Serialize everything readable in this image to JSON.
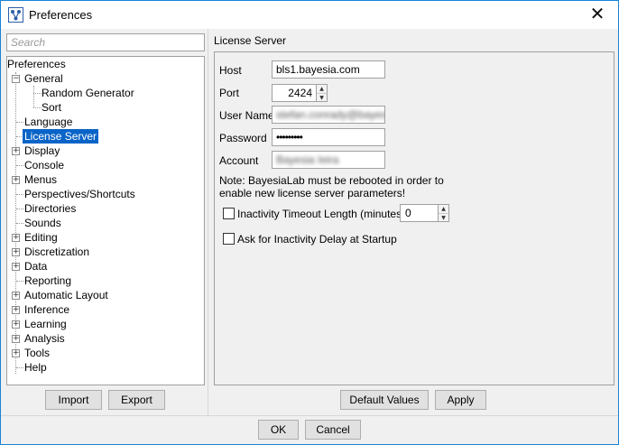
{
  "window": {
    "title": "Preferences",
    "close_glyph": "✕",
    "app_icon": "bayesialab-app-icon"
  },
  "search": {
    "placeholder": "Search",
    "value": ""
  },
  "tree": {
    "root": "Preferences",
    "items": [
      {
        "label": "General",
        "expander": "−"
      },
      {
        "label": "Random Generator"
      },
      {
        "label": "Sort"
      },
      {
        "label": "Language"
      },
      {
        "label": "License Server",
        "selected": true
      },
      {
        "label": "Display",
        "expander": "+"
      },
      {
        "label": "Console"
      },
      {
        "label": "Menus",
        "expander": "+"
      },
      {
        "label": "Perspectives/Shortcuts"
      },
      {
        "label": "Directories"
      },
      {
        "label": "Sounds"
      },
      {
        "label": "Editing",
        "expander": "+"
      },
      {
        "label": "Discretization",
        "expander": "+"
      },
      {
        "label": "Data",
        "expander": "+"
      },
      {
        "label": "Reporting"
      },
      {
        "label": "Automatic Layout",
        "expander": "+"
      },
      {
        "label": "Inference",
        "expander": "+"
      },
      {
        "label": "Learning",
        "expander": "+"
      },
      {
        "label": "Analysis",
        "expander": "+"
      },
      {
        "label": "Tools",
        "expander": "+"
      },
      {
        "label": "Help"
      }
    ]
  },
  "left_buttons": {
    "import": "Import",
    "export": "Export"
  },
  "license_server": {
    "title": "License Server",
    "host_label": "Host",
    "host_value": "bls1.bayesia.com",
    "port_label": "Port",
    "port_value": "2424",
    "username_label": "User Name",
    "username_value": "stefan.conrady@bayesia",
    "password_label": "Password",
    "password_value": "•••••••••",
    "account_label": "Account",
    "account_value": "Bayesia Ieira",
    "note_line1": "Note: BayesiaLab must be rebooted in order to",
    "note_line2": "enable new license server parameters!",
    "inactivity_label": "Inactivity Timeout Length (minutes)",
    "inactivity_checked": false,
    "inactivity_value": "0",
    "ask_delay_label": "Ask for Inactivity Delay at Startup",
    "ask_delay_checked": false
  },
  "right_buttons": {
    "default_values": "Default Values",
    "apply": "Apply"
  },
  "dialog_buttons": {
    "ok": "OK",
    "cancel": "Cancel"
  },
  "colors": {
    "selection": "#0a64c8",
    "window_border": "#1883d7",
    "background": "#f0f0f0"
  }
}
